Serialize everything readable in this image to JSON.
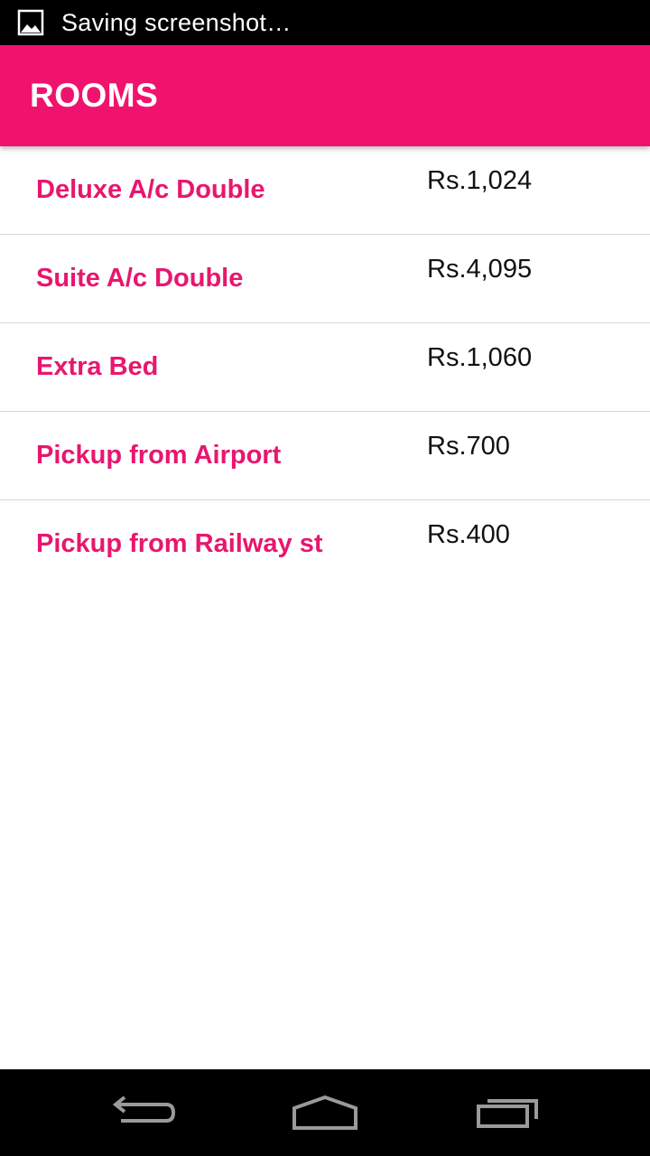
{
  "status_bar": {
    "notification_icon": "image-icon",
    "text": "Saving screenshot…"
  },
  "app_bar": {
    "title": "ROOMS",
    "color": "#f0136d"
  },
  "rooms": [
    {
      "name": "Deluxe A/c Double",
      "price": "Rs.1,024"
    },
    {
      "name": "Suite A/c Double",
      "price": "Rs.4,095"
    },
    {
      "name": "Extra Bed",
      "price": "Rs.1,060"
    },
    {
      "name": "Pickup from Airport",
      "price": "Rs.700"
    },
    {
      "name": "Pickup from Railway st",
      "price": "Rs.400"
    }
  ],
  "accent_color": "#e8166f",
  "nav_bar": {
    "icons": [
      "back-icon",
      "home-icon",
      "recent-apps-icon"
    ]
  }
}
